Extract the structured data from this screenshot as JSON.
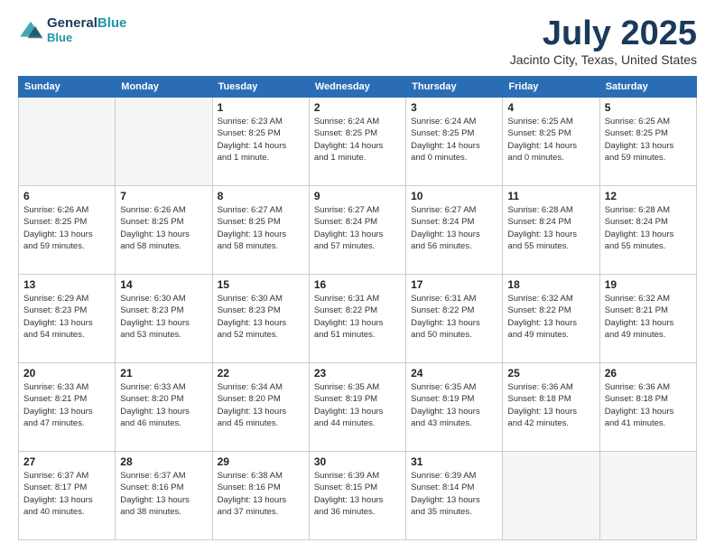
{
  "header": {
    "logo_line1": "General",
    "logo_line2": "Blue",
    "month": "July 2025",
    "location": "Jacinto City, Texas, United States"
  },
  "weekdays": [
    "Sunday",
    "Monday",
    "Tuesday",
    "Wednesday",
    "Thursday",
    "Friday",
    "Saturday"
  ],
  "weeks": [
    [
      {
        "day": "",
        "info": ""
      },
      {
        "day": "",
        "info": ""
      },
      {
        "day": "1",
        "info": "Sunrise: 6:23 AM\nSunset: 8:25 PM\nDaylight: 14 hours\nand 1 minute."
      },
      {
        "day": "2",
        "info": "Sunrise: 6:24 AM\nSunset: 8:25 PM\nDaylight: 14 hours\nand 1 minute."
      },
      {
        "day": "3",
        "info": "Sunrise: 6:24 AM\nSunset: 8:25 PM\nDaylight: 14 hours\nand 0 minutes."
      },
      {
        "day": "4",
        "info": "Sunrise: 6:25 AM\nSunset: 8:25 PM\nDaylight: 14 hours\nand 0 minutes."
      },
      {
        "day": "5",
        "info": "Sunrise: 6:25 AM\nSunset: 8:25 PM\nDaylight: 13 hours\nand 59 minutes."
      }
    ],
    [
      {
        "day": "6",
        "info": "Sunrise: 6:26 AM\nSunset: 8:25 PM\nDaylight: 13 hours\nand 59 minutes."
      },
      {
        "day": "7",
        "info": "Sunrise: 6:26 AM\nSunset: 8:25 PM\nDaylight: 13 hours\nand 58 minutes."
      },
      {
        "day": "8",
        "info": "Sunrise: 6:27 AM\nSunset: 8:25 PM\nDaylight: 13 hours\nand 58 minutes."
      },
      {
        "day": "9",
        "info": "Sunrise: 6:27 AM\nSunset: 8:24 PM\nDaylight: 13 hours\nand 57 minutes."
      },
      {
        "day": "10",
        "info": "Sunrise: 6:27 AM\nSunset: 8:24 PM\nDaylight: 13 hours\nand 56 minutes."
      },
      {
        "day": "11",
        "info": "Sunrise: 6:28 AM\nSunset: 8:24 PM\nDaylight: 13 hours\nand 55 minutes."
      },
      {
        "day": "12",
        "info": "Sunrise: 6:28 AM\nSunset: 8:24 PM\nDaylight: 13 hours\nand 55 minutes."
      }
    ],
    [
      {
        "day": "13",
        "info": "Sunrise: 6:29 AM\nSunset: 8:23 PM\nDaylight: 13 hours\nand 54 minutes."
      },
      {
        "day": "14",
        "info": "Sunrise: 6:30 AM\nSunset: 8:23 PM\nDaylight: 13 hours\nand 53 minutes."
      },
      {
        "day": "15",
        "info": "Sunrise: 6:30 AM\nSunset: 8:23 PM\nDaylight: 13 hours\nand 52 minutes."
      },
      {
        "day": "16",
        "info": "Sunrise: 6:31 AM\nSunset: 8:22 PM\nDaylight: 13 hours\nand 51 minutes."
      },
      {
        "day": "17",
        "info": "Sunrise: 6:31 AM\nSunset: 8:22 PM\nDaylight: 13 hours\nand 50 minutes."
      },
      {
        "day": "18",
        "info": "Sunrise: 6:32 AM\nSunset: 8:22 PM\nDaylight: 13 hours\nand 49 minutes."
      },
      {
        "day": "19",
        "info": "Sunrise: 6:32 AM\nSunset: 8:21 PM\nDaylight: 13 hours\nand 49 minutes."
      }
    ],
    [
      {
        "day": "20",
        "info": "Sunrise: 6:33 AM\nSunset: 8:21 PM\nDaylight: 13 hours\nand 47 minutes."
      },
      {
        "day": "21",
        "info": "Sunrise: 6:33 AM\nSunset: 8:20 PM\nDaylight: 13 hours\nand 46 minutes."
      },
      {
        "day": "22",
        "info": "Sunrise: 6:34 AM\nSunset: 8:20 PM\nDaylight: 13 hours\nand 45 minutes."
      },
      {
        "day": "23",
        "info": "Sunrise: 6:35 AM\nSunset: 8:19 PM\nDaylight: 13 hours\nand 44 minutes."
      },
      {
        "day": "24",
        "info": "Sunrise: 6:35 AM\nSunset: 8:19 PM\nDaylight: 13 hours\nand 43 minutes."
      },
      {
        "day": "25",
        "info": "Sunrise: 6:36 AM\nSunset: 8:18 PM\nDaylight: 13 hours\nand 42 minutes."
      },
      {
        "day": "26",
        "info": "Sunrise: 6:36 AM\nSunset: 8:18 PM\nDaylight: 13 hours\nand 41 minutes."
      }
    ],
    [
      {
        "day": "27",
        "info": "Sunrise: 6:37 AM\nSunset: 8:17 PM\nDaylight: 13 hours\nand 40 minutes."
      },
      {
        "day": "28",
        "info": "Sunrise: 6:37 AM\nSunset: 8:16 PM\nDaylight: 13 hours\nand 38 minutes."
      },
      {
        "day": "29",
        "info": "Sunrise: 6:38 AM\nSunset: 8:16 PM\nDaylight: 13 hours\nand 37 minutes."
      },
      {
        "day": "30",
        "info": "Sunrise: 6:39 AM\nSunset: 8:15 PM\nDaylight: 13 hours\nand 36 minutes."
      },
      {
        "day": "31",
        "info": "Sunrise: 6:39 AM\nSunset: 8:14 PM\nDaylight: 13 hours\nand 35 minutes."
      },
      {
        "day": "",
        "info": ""
      },
      {
        "day": "",
        "info": ""
      }
    ]
  ]
}
